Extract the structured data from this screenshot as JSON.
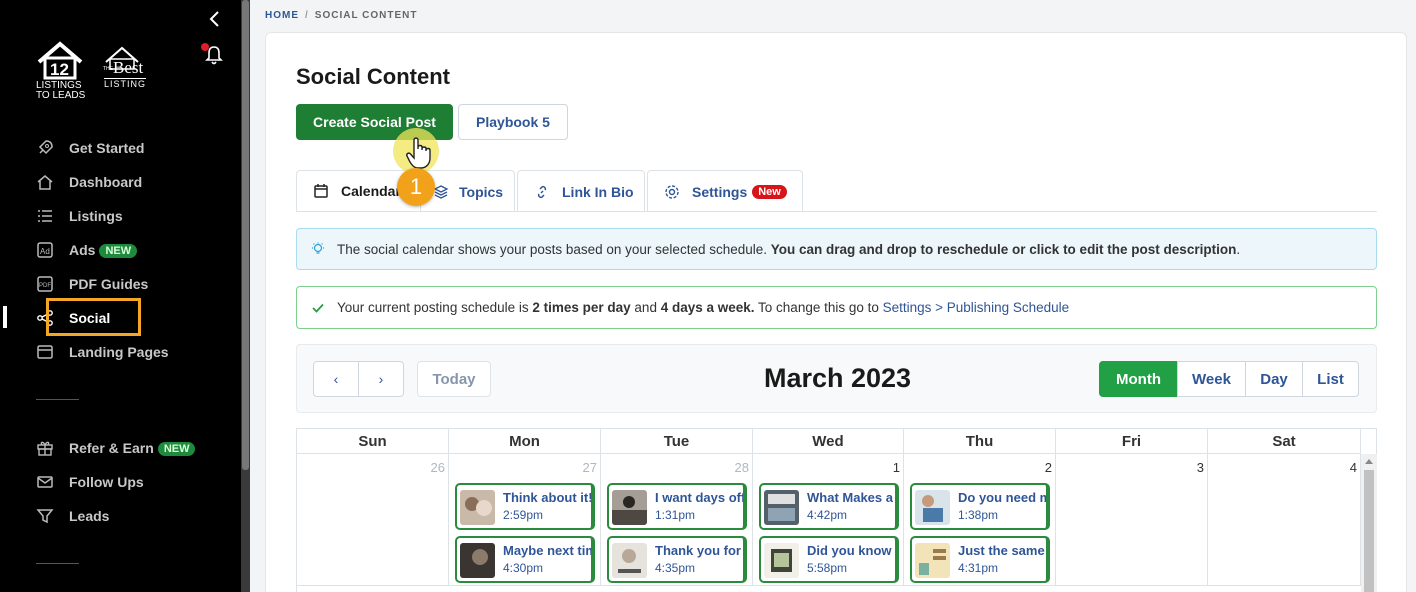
{
  "sidebar": {
    "logo_main_text": "LISTINGS TO LEADS",
    "logo_brand_the": "THE",
    "logo_brand_best": "Best",
    "logo_brand_listing": "LISTING",
    "items": [
      {
        "label": "Get Started",
        "icon": "rocket-icon"
      },
      {
        "label": "Dashboard",
        "icon": "home-icon"
      },
      {
        "label": "Listings",
        "icon": "list-icon"
      },
      {
        "label": "Ads",
        "icon": "ad-icon",
        "badge": "NEW"
      },
      {
        "label": "PDF Guides",
        "icon": "pdf-icon"
      },
      {
        "label": "Social",
        "icon": "share-icon",
        "active": true
      },
      {
        "label": "Landing Pages",
        "icon": "page-icon"
      },
      {
        "label": "Refer & Earn",
        "icon": "gift-icon",
        "badge": "NEW"
      },
      {
        "label": "Follow Ups",
        "icon": "mail-icon"
      },
      {
        "label": "Leads",
        "icon": "filter-icon"
      }
    ]
  },
  "breadcrumb": {
    "home": "HOME",
    "separator": "/",
    "current": "SOCIAL CONTENT"
  },
  "page": {
    "title": "Social Content"
  },
  "buttons": {
    "create": "Create Social Post",
    "playbook": "Playbook 5"
  },
  "tabs": [
    {
      "label": "Calendar",
      "icon": "calendar-icon"
    },
    {
      "label": "Topics",
      "icon": "layers-icon"
    },
    {
      "label": "Link In Bio",
      "icon": "link-icon"
    },
    {
      "label": "Settings",
      "icon": "gear-icon",
      "badge": "New"
    }
  ],
  "alerts": {
    "info_text": "The social calendar shows your posts based on your selected schedule. ",
    "info_bold": "You can drag and drop to reschedule or click to edit the post description",
    "info_end": ".",
    "success_a": "Your current posting schedule is ",
    "success_b": "2 times per day",
    "success_c": " and ",
    "success_d": "4 days a week.",
    "success_e": " To change this go to ",
    "success_link": "Settings > Publishing Schedule"
  },
  "calendar": {
    "title": "March 2023",
    "prev": "‹",
    "next": "›",
    "today": "Today",
    "views": [
      "Month",
      "Week",
      "Day",
      "List"
    ],
    "weekdays": [
      "Sun",
      "Mon",
      "Tue",
      "Wed",
      "Thu",
      "Fri",
      "Sat"
    ],
    "days": [
      "26",
      "27",
      "28",
      "1",
      "2",
      "3",
      "4"
    ],
    "posts": {
      "mon": [
        {
          "title": "Think about it!",
          "time": "2:59pm"
        },
        {
          "title": "Maybe next tim",
          "time": "4:30pm"
        }
      ],
      "tue": [
        {
          "title": "I want days off",
          "time": "1:31pm"
        },
        {
          "title": "Thank you for",
          "time": "4:35pm"
        }
      ],
      "wed": [
        {
          "title": "What Makes a",
          "time": "4:42pm"
        },
        {
          "title": "Did you know",
          "time": "5:58pm"
        }
      ],
      "thu": [
        {
          "title": "Do you need m",
          "time": "1:38pm"
        },
        {
          "title": "Just the same w",
          "time": "4:31pm"
        }
      ]
    }
  },
  "overlay": {
    "step": "1"
  },
  "colors": {
    "primary_green": "#1e7e34",
    "view_active": "#21a045",
    "link_blue": "#2f5597",
    "highlight": "#f5a623",
    "step_badge": "#f2a21a"
  }
}
